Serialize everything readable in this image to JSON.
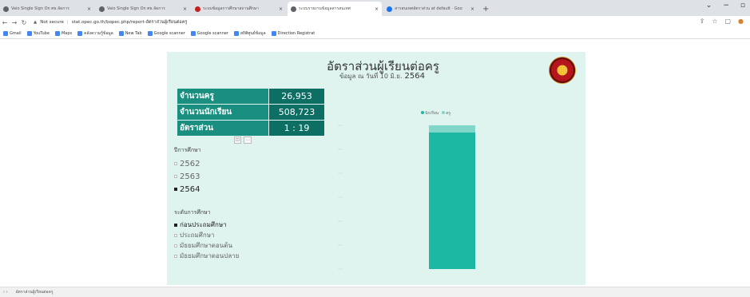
{
  "browser": {
    "tabs": [
      {
        "label": "Vaio Single Sign On ศธ.จัดการ",
        "active": false,
        "fav": "grey"
      },
      {
        "label": "Vaio Single Sign On ศธ.จัดการ",
        "active": false,
        "fav": "grey"
      },
      {
        "label": "ระบบข้อมูลการศึกษาสถานศึกษา",
        "active": false,
        "fav": "red"
      },
      {
        "label": "ระบบรายงานข้อมูลสารสนเทศ",
        "active": true,
        "fav": "grey"
      },
      {
        "label": "สารสนเทศอัตราส่วน at default · Goo",
        "active": false,
        "fav": "blue"
      }
    ],
    "new_tab": "+",
    "address": {
      "security": "Not secure",
      "url": "stat.opec.go.th/bopec.php/report-อัตราส่วนผู้เรียนต่อครู"
    },
    "bookmarks": [
      "Gmail",
      "YouTube",
      "Maps",
      "คลังความรู้ข้อมูล",
      "New Tab",
      "Google scanner",
      "Google scanner",
      "สถิติศูนย์ข้อมูล",
      "Direction Registrat"
    ]
  },
  "report": {
    "title": "อัตราส่วนผู้เรียนต่อครู",
    "subtitle": "ข้อมูล ณ วันที่ 10 มิ.ย.",
    "subtitle_year": "2564",
    "kpis": [
      {
        "label": "จำนวนครู",
        "value": "26,953"
      },
      {
        "label": "จำนวนนักเรียน",
        "value": "508,723"
      },
      {
        "label": "อัตราส่วน",
        "value": "1 : 19"
      }
    ],
    "year_slicer": {
      "title": "ปีการศึกษา",
      "items": [
        {
          "label": "2562",
          "selected": false
        },
        {
          "label": "2563",
          "selected": false
        },
        {
          "label": "2564",
          "selected": true
        }
      ]
    },
    "level_slicer": {
      "title": "ระดับการศึกษา",
      "items": [
        {
          "label": "ก่อนประถมศึกษา",
          "selected": true
        },
        {
          "label": "ประถมศึกษา",
          "selected": false
        },
        {
          "label": "มัธยมศึกษาตอนต้น",
          "selected": false
        },
        {
          "label": "มัธยมศึกษาตอนปลาย",
          "selected": false
        }
      ]
    }
  },
  "chart_data": {
    "type": "bar",
    "stacked": true,
    "categories": [
      ""
    ],
    "series": [
      {
        "name": "นักเรียน",
        "color": "#1db8a4",
        "values": [
          0.95
        ]
      },
      {
        "name": "ครู",
        "color": "#7fd6c9",
        "values": [
          0.05
        ]
      }
    ],
    "ylim": [
      0,
      1
    ]
  },
  "statusbar": {
    "page_tab": "อัตราส่วนผู้เรียนต่อครู"
  }
}
